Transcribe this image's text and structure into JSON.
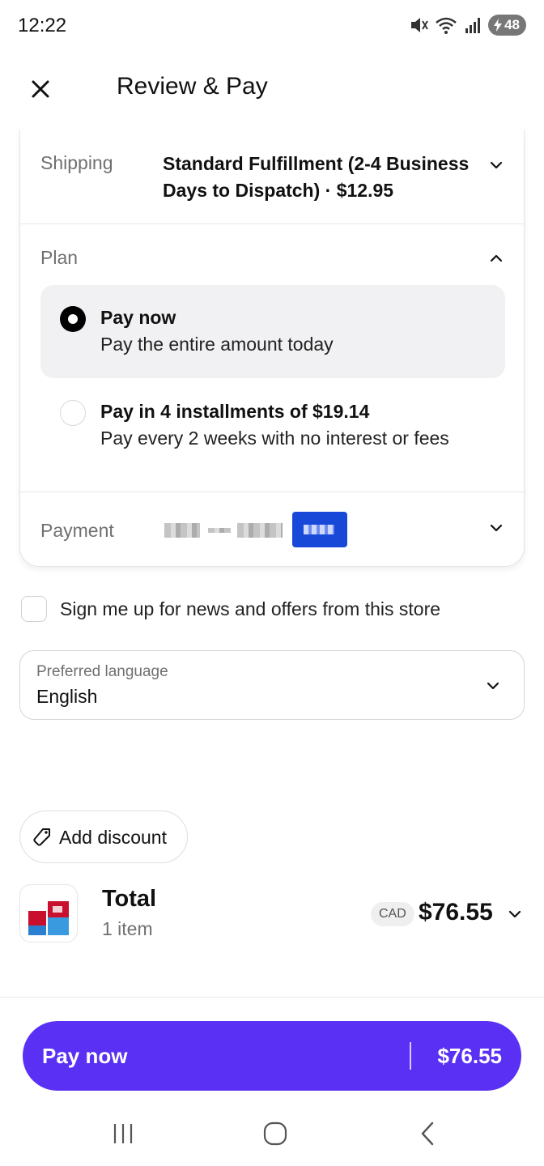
{
  "status_bar": {
    "time": "12:22",
    "battery": "48"
  },
  "header": {
    "title": "Review & Pay"
  },
  "shipping": {
    "label": "Shipping",
    "value": "Standard Fulfillment (2-4 Business Days to Dispatch) · $12.95"
  },
  "plan": {
    "label": "Plan",
    "options": [
      {
        "title": "Pay now",
        "subtitle": "Pay the entire amount today",
        "selected": true
      },
      {
        "title": "Pay in 4 installments of $19.14",
        "subtitle": "Pay every 2 weeks with no interest or fees",
        "selected": false
      }
    ]
  },
  "payment": {
    "label": "Payment"
  },
  "newsletter": {
    "label": "Sign me up for news and offers from this store",
    "checked": false
  },
  "language": {
    "label": "Preferred language",
    "value": "English"
  },
  "discount": {
    "label": "Add discount"
  },
  "total": {
    "label": "Total",
    "items": "1 item",
    "currency": "CAD",
    "amount": "$76.55"
  },
  "pay_button": {
    "label": "Pay now",
    "amount": "$76.55"
  },
  "colors": {
    "accent": "#5a31f4",
    "selected_bg": "#f1f1f3"
  }
}
